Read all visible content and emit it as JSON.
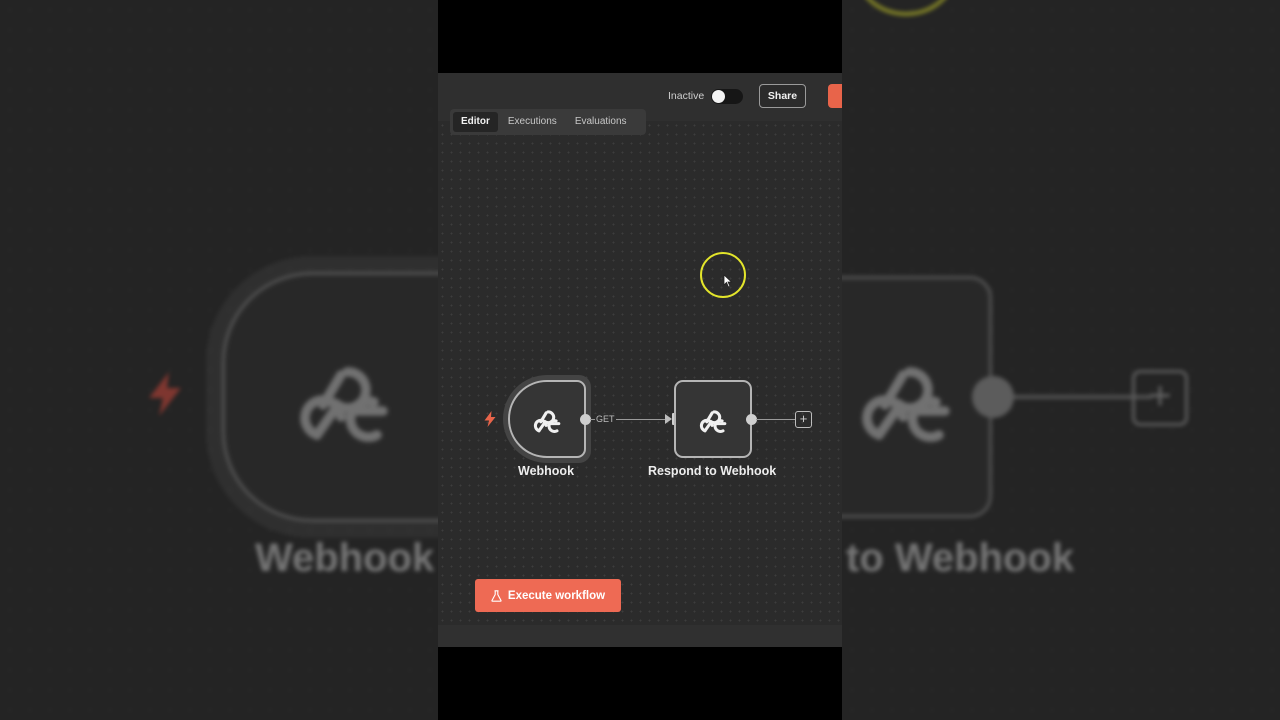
{
  "topbar": {
    "status_label": "Inactive",
    "share_label": "Share"
  },
  "tabs": [
    {
      "label": "Editor",
      "active": true
    },
    {
      "label": "Executions",
      "active": false
    },
    {
      "label": "Evaluations",
      "active": false
    }
  ],
  "nodes": {
    "webhook": {
      "label": "Webhook",
      "icon": "webhook-icon"
    },
    "respond": {
      "label": "Respond to Webhook",
      "icon": "webhook-icon"
    }
  },
  "connection": {
    "method_label": "GET"
  },
  "execute_button": {
    "label": "Execute workflow",
    "icon": "flask-icon"
  },
  "backdrop": {
    "left_label": "Webhook",
    "right_label": "to Webhook"
  },
  "colors": {
    "accent": "#ee6a54",
    "trigger": "#e8644a",
    "cursor_ring": "#e3e52b",
    "canvas": "#2b2b2b"
  }
}
